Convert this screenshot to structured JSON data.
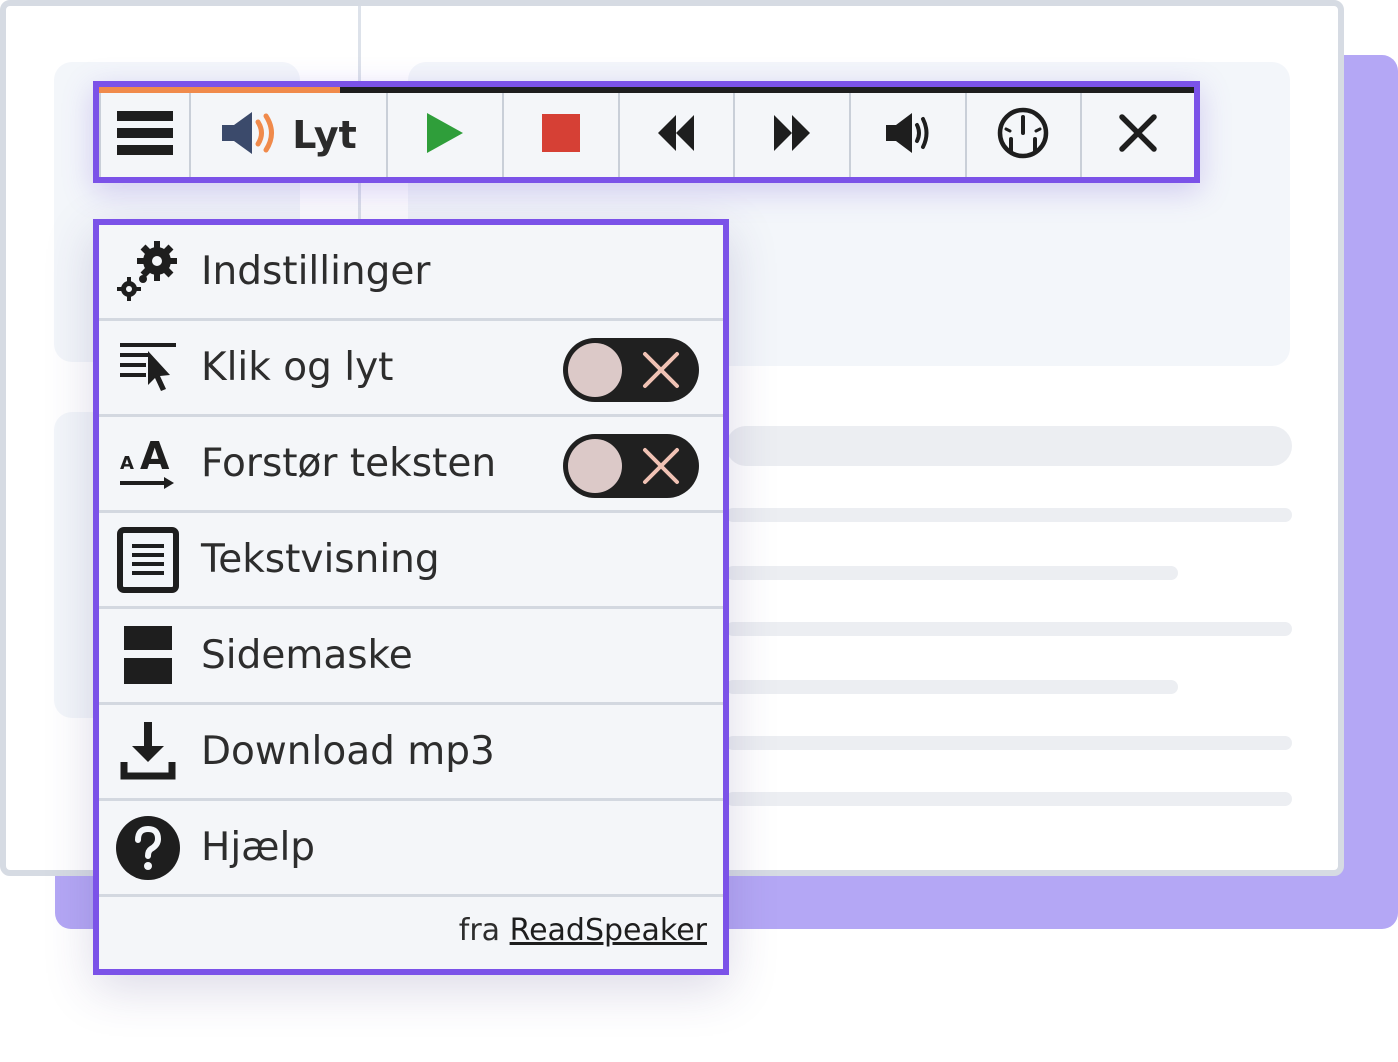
{
  "toolbar": {
    "listen_label": "Lyt",
    "progress_fraction": 0.22,
    "buttons": [
      "menu-icon",
      "speaker-icon",
      "play-icon",
      "stop-icon",
      "rewind-icon",
      "fast-forward-icon",
      "volume-icon",
      "speed-icon",
      "close-icon"
    ]
  },
  "menu": {
    "items": [
      {
        "label": "Indstillinger",
        "icon": "gears-icon"
      },
      {
        "label": "Klik og lyt",
        "icon": "click-and-listen-icon",
        "toggle": "off"
      },
      {
        "label": "Forstør teksten",
        "icon": "enlarge-text-icon",
        "toggle": "off"
      },
      {
        "label": "Tekstvisning",
        "icon": "text-view-icon"
      },
      {
        "label": "Sidemaske",
        "icon": "page-mask-icon"
      },
      {
        "label": "Download mp3",
        "icon": "download-icon"
      },
      {
        "label": "Hjælp",
        "icon": "help-icon"
      }
    ],
    "footer_prefix": "fra",
    "footer_link": "ReadSpeaker"
  },
  "colors": {
    "accent": "#7b52e8",
    "shadow_block": "#b4a7f5",
    "progress": "#f08a4b",
    "play": "#2f9e3a",
    "stop": "#d64035",
    "speaker_orange": "#f08a4b",
    "speaker_blue": "#3b4a6b"
  }
}
